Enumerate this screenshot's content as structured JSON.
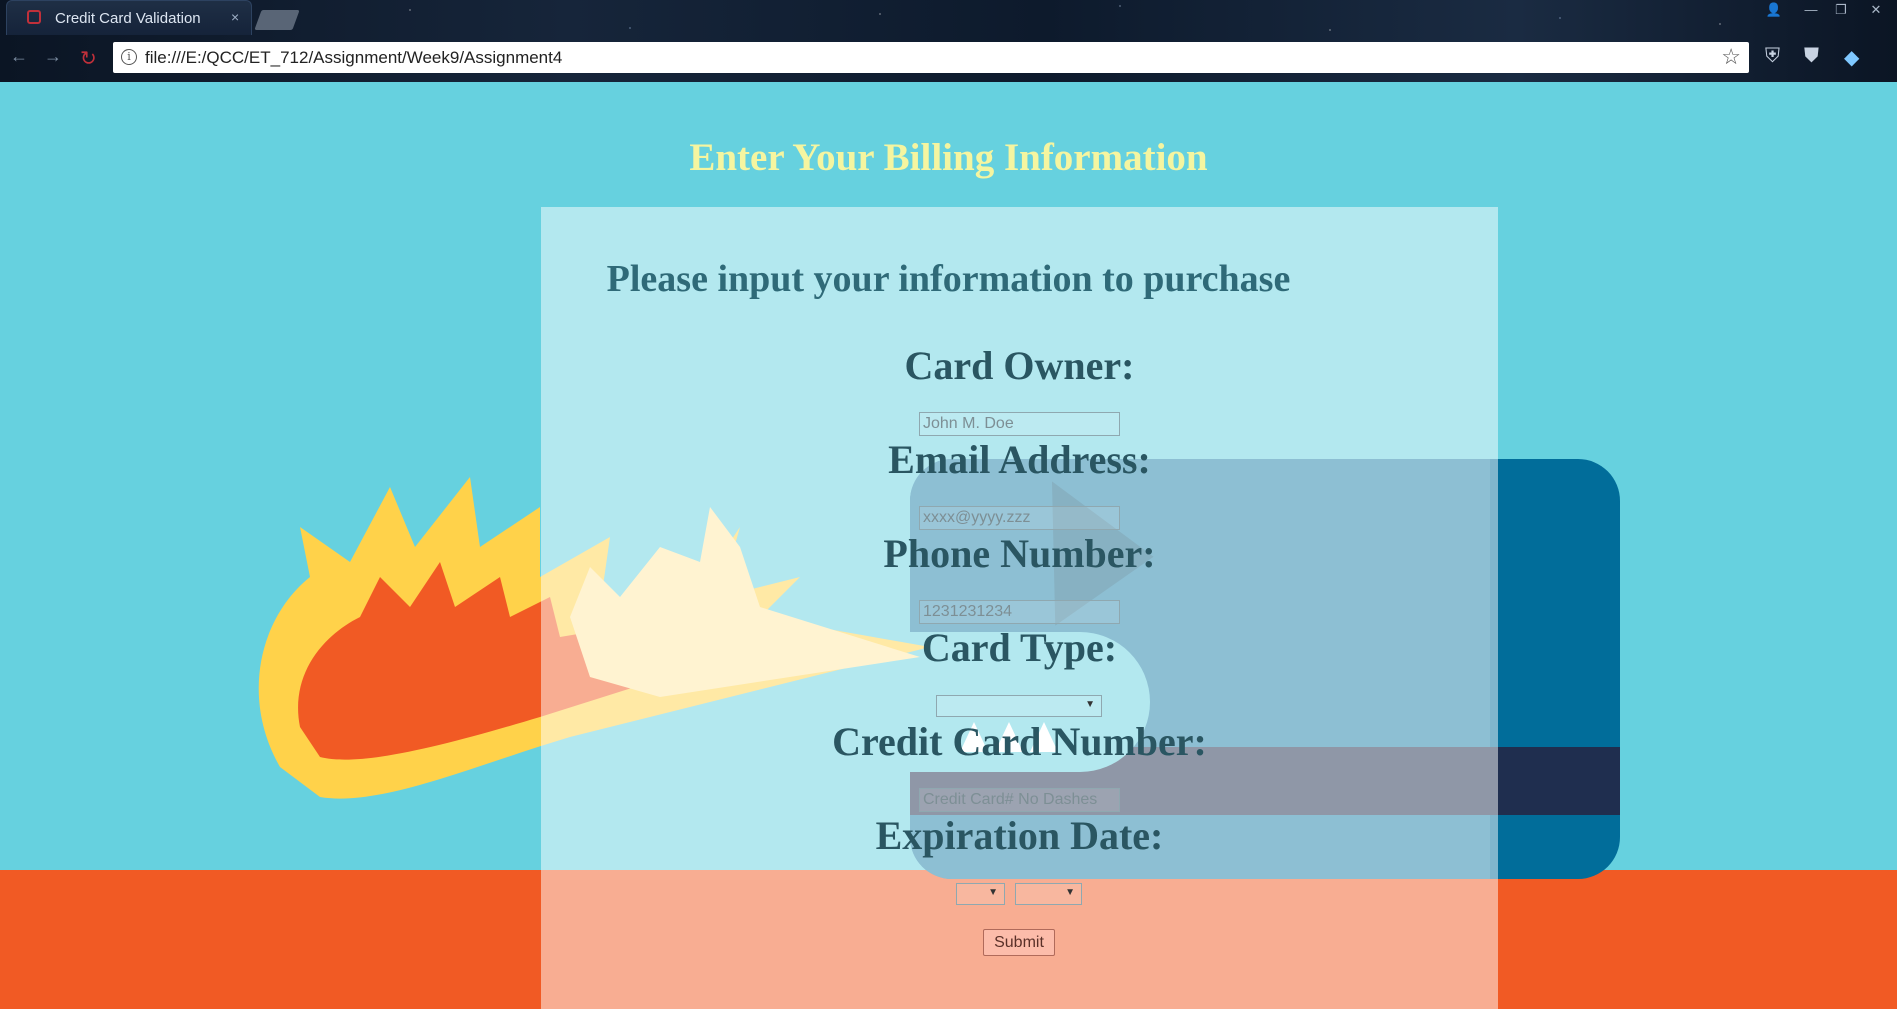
{
  "browser": {
    "tab_title": "Credit Card Validation",
    "tab_close": "×",
    "url": "file:///E:/QCC/ET_712/Assignment/Week9/Assignment4",
    "info_glyph": "i",
    "star_glyph": "☆",
    "back_glyph": "←",
    "forward_glyph": "→",
    "reload_glyph": "↻",
    "window_profile": "👤",
    "window_min": "—",
    "window_max": "❐",
    "window_close": "✕"
  },
  "page": {
    "main_title": "Enter Your Billing Information",
    "sub_title": "Please input your information to purchase"
  },
  "form": {
    "owner_label": "Card Owner:",
    "owner_placeholder": "John M. Doe",
    "email_label": "Email Address:",
    "email_placeholder": "xxxx@yyyy.zzz",
    "phone_label": "Phone Number:",
    "phone_placeholder": "1231231234",
    "card_type_label": "Card Type:",
    "card_type_value": "",
    "card_number_label": "Credit Card Number:",
    "card_number_placeholder": "Credit Card# No Dashes",
    "expiration_label": "Expiration Date:",
    "exp_month_value": "",
    "exp_year_value": "",
    "submit_label": "Submit"
  },
  "colors": {
    "background": "#66d1df",
    "ground": "#f15a24",
    "title": "#f5f5a0",
    "label": "#2a5662"
  }
}
